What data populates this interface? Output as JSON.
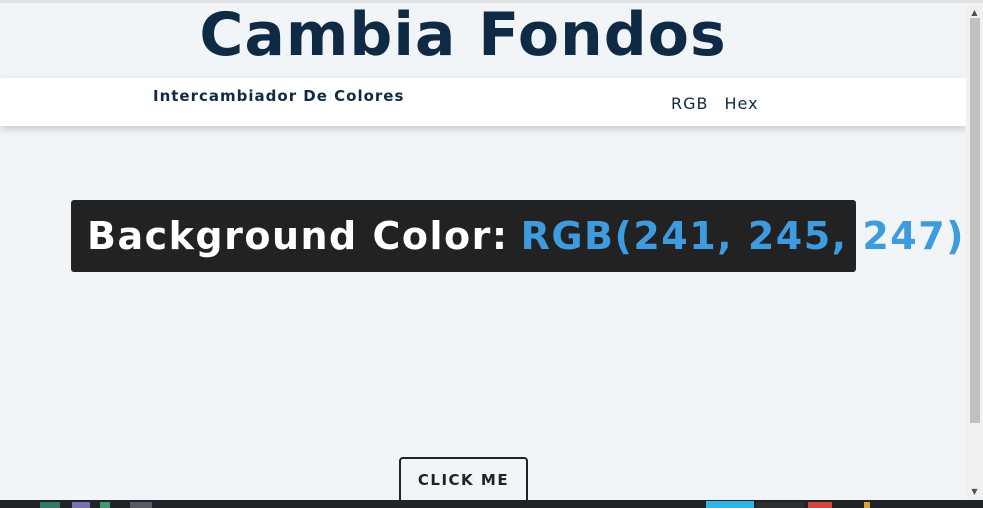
{
  "header": {
    "title": "Cambia Fondos"
  },
  "nav": {
    "brand": "Intercambiador De Colores",
    "links": [
      {
        "label": "RGB"
      },
      {
        "label": "Hex"
      }
    ]
  },
  "main": {
    "color_label": "Background Color:",
    "color_value": "RGB(241, 245, 247)",
    "button_label": "CLICK ME"
  },
  "colors": {
    "background": "#f1f5f7",
    "title": "#0f2a44",
    "box": "#222222",
    "accent": "#3d9be0"
  },
  "scrollbar": {
    "up_icon": "chevron-up-icon",
    "down_icon": "chevron-down-icon"
  }
}
